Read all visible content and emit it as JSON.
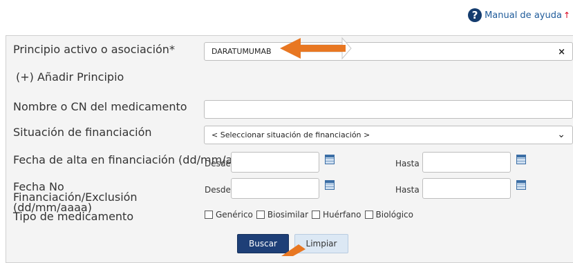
{
  "help": {
    "label": "Manual de ayuda",
    "mark": "↑"
  },
  "form": {
    "principio_label": "Principio activo o asociación*",
    "principio_value": "DARATUMUMAB",
    "clear": "×",
    "add_principio": "(+) Añadir Principio",
    "nombre_label": "Nombre o CN del medicamento",
    "nombre_value": "",
    "situacion_label": "Situación de financiación",
    "situacion_value": "< Seleccionar situación de financiación >",
    "fecha_alta_label": "Fecha de alta en financiación (dd/mm/aaaa)",
    "fecha_no_label": "Fecha No Financiación/Exclusión (dd/mm/aaaa)",
    "desde": "Desde",
    "hasta": "Hasta",
    "tipo_label": "Tipo de medicamento",
    "tipos": [
      "Genérico",
      "Biosimilar",
      "Huérfano",
      "Biológico"
    ],
    "buscar": "Buscar",
    "limpiar": "Limpiar"
  },
  "colors": {
    "annotation": "#e87722",
    "primary": "#1e3f77"
  }
}
